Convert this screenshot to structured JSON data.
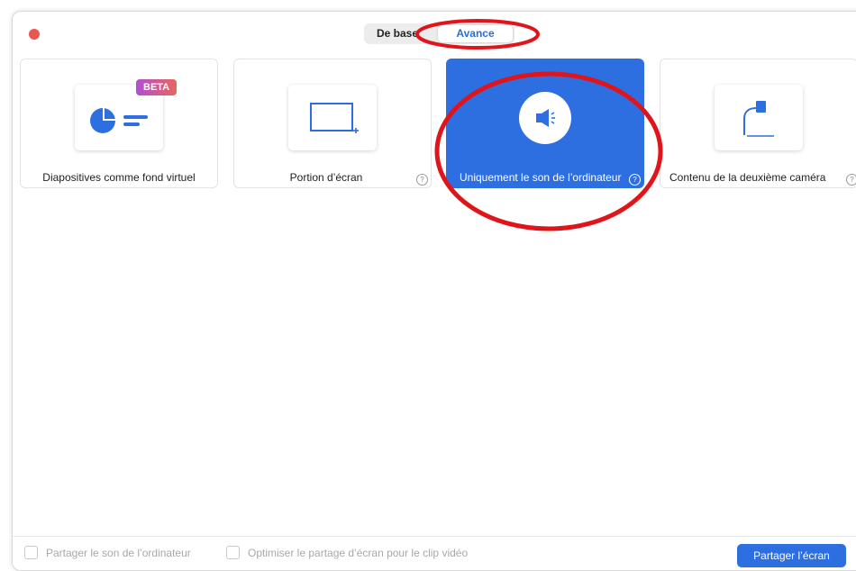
{
  "tabs": {
    "basic": "De base",
    "advanced": "Avance"
  },
  "cards": [
    {
      "label": "Diapositives comme fond virtuel",
      "badge": "BETA",
      "icon": "slides-background-icon"
    },
    {
      "label": "Portion d’écran",
      "icon": "screen-portion-icon"
    },
    {
      "label": "Uniquement le son de l’ordinateur",
      "icon": "speaker-icon",
      "selected": true
    },
    {
      "label": "Contenu de la deuxième caméra",
      "icon": "second-camera-icon"
    }
  ],
  "footer": {
    "share_sound": "Partager le son de l’ordinateur",
    "optimize_video": "Optimiser le partage d’écran pour le clip vidéo",
    "share_button": "Partager l’écran"
  },
  "colors": {
    "accent": "#2d6fe0",
    "close_dot": "#e9584f",
    "annotation": "#e0141b"
  }
}
